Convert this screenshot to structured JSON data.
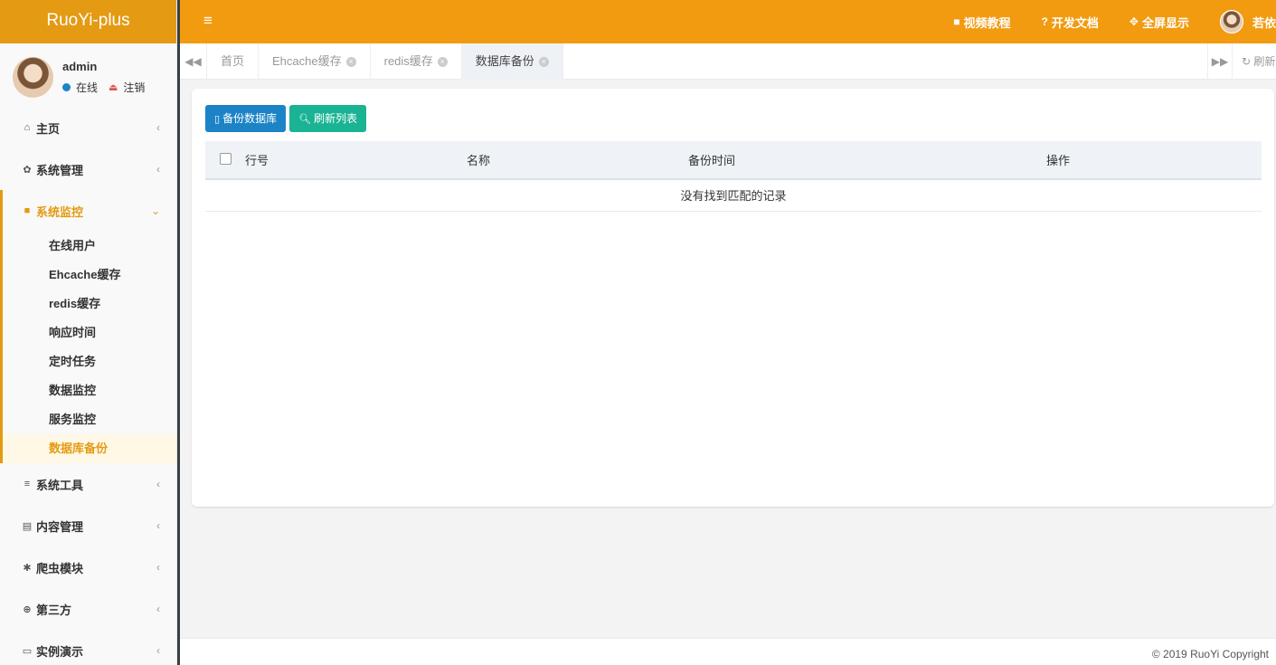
{
  "brand": "RuoYi-plus",
  "user": {
    "name": "admin",
    "status": "在线",
    "logout": "注销"
  },
  "sidebar": {
    "items_top": [
      {
        "icon": "home-icon",
        "glyph": "⌂",
        "label": "主页"
      },
      {
        "icon": "gear-icon",
        "glyph": "✿",
        "label": "系统管理"
      }
    ],
    "active_group": {
      "icon": "video-camera-icon",
      "glyph": "■",
      "label": "系统监控"
    },
    "subitems": [
      {
        "label": "在线用户",
        "active": false
      },
      {
        "label": "Ehcache缓存",
        "active": false
      },
      {
        "label": "redis缓存",
        "active": false
      },
      {
        "label": "响应时间",
        "active": false
      },
      {
        "label": "定时任务",
        "active": false
      },
      {
        "label": "数据监控",
        "active": false
      },
      {
        "label": "服务监控",
        "active": false
      },
      {
        "label": "数据库备份",
        "active": true
      }
    ],
    "items_bottom": [
      {
        "icon": "list-icon",
        "glyph": "≡",
        "label": "系统工具"
      },
      {
        "icon": "id-card-icon",
        "glyph": "▤",
        "label": "内容管理"
      },
      {
        "icon": "bug-icon",
        "glyph": "✱",
        "label": "爬虫模块"
      },
      {
        "icon": "life-ring-icon",
        "glyph": "⊕",
        "label": "第三方"
      },
      {
        "icon": "window-icon",
        "glyph": "▭",
        "label": "实例演示"
      }
    ]
  },
  "topbar": {
    "video": "视频教程",
    "docs": "开发文档",
    "fullscreen": "全屏显示",
    "username": "若依"
  },
  "tabs": [
    {
      "label": "首页",
      "closable": false,
      "active": false
    },
    {
      "label": "Ehcache缓存",
      "closable": true,
      "active": false
    },
    {
      "label": "redis缓存",
      "closable": true,
      "active": false
    },
    {
      "label": "数据库备份",
      "closable": true,
      "active": true
    }
  ],
  "tabs_refresh": "刷新",
  "toolbar": {
    "backup": "备份数据库",
    "refresh": "刷新列表"
  },
  "table": {
    "headers": [
      "行号",
      "名称",
      "备份时间",
      "操作"
    ],
    "empty": "没有找到匹配的记录"
  },
  "footer": "© 2019 RuoYi Copyright",
  "colors": {
    "accent": "#f29b11",
    "primary": "#1c84c6",
    "success": "#1ab394"
  }
}
